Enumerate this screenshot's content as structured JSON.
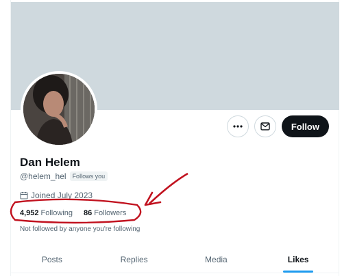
{
  "profile": {
    "display_name": "Dan Helem",
    "handle": "@helem_hel",
    "follows_you_badge": "Follows you",
    "joined": "Joined July 2023",
    "following_count": "4,952",
    "following_label": "Following",
    "followers_count": "86",
    "followers_label": "Followers",
    "not_followed_text": "Not followed by anyone you're following"
  },
  "actions": {
    "more_icon": "more-icon",
    "message_icon": "mail-icon",
    "follow_label": "Follow"
  },
  "tabs": [
    {
      "label": "Posts",
      "active": false
    },
    {
      "label": "Replies",
      "active": false
    },
    {
      "label": "Media",
      "active": false
    },
    {
      "label": "Likes",
      "active": true
    }
  ],
  "colors": {
    "banner": "#cfd9de",
    "accent": "#1d9bf0",
    "annotation": "#c1121f",
    "follow_button": "#0f1419"
  }
}
